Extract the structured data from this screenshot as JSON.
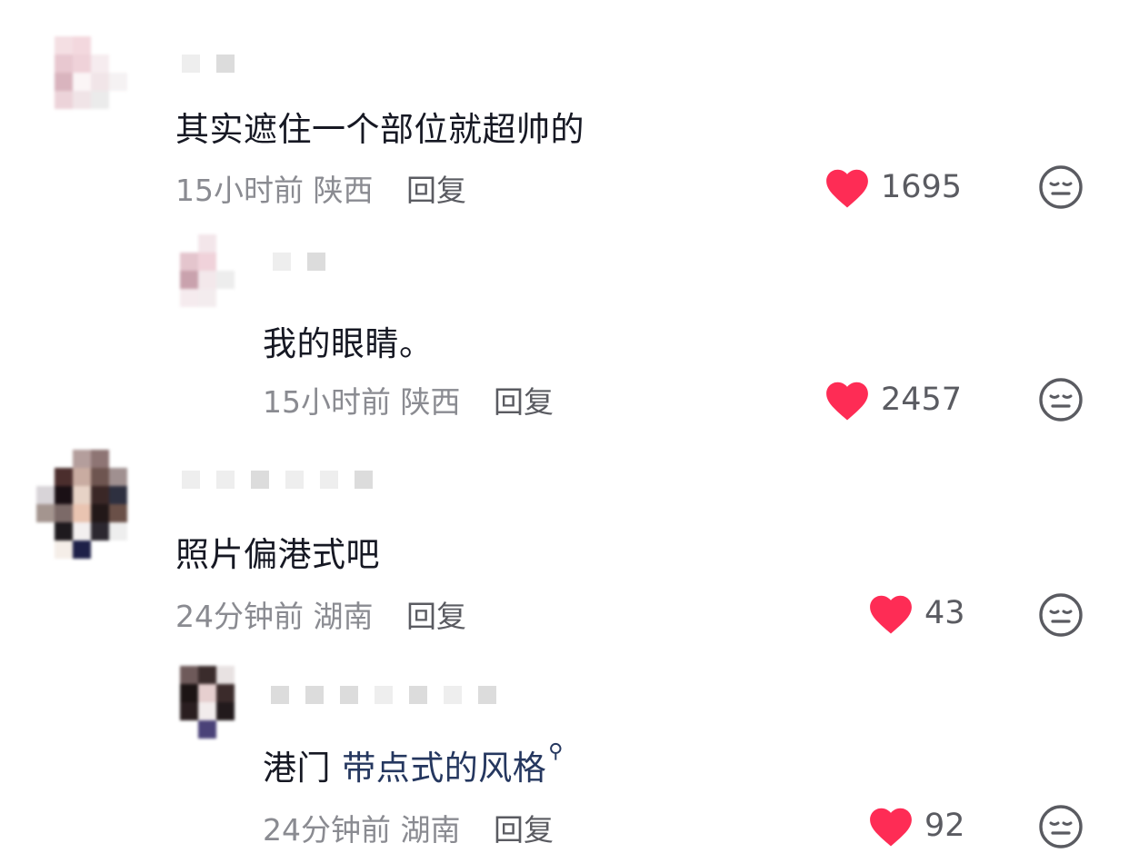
{
  "colors": {
    "like_heart": "#fe2c55",
    "meta": "#8a8b91",
    "link": "#25375f"
  },
  "comments": [
    {
      "text": "其实遮住一个部位就超帅的",
      "time": "15小时前",
      "location": "陕西",
      "reply_label": "回复",
      "likes": "1695"
    },
    {
      "text": "我的眼睛。",
      "time": "15小时前",
      "location": "陕西",
      "reply_label": "回复",
      "likes": "2457"
    },
    {
      "text": "照片偏港式吧",
      "time": "24分钟前",
      "location": "湖南",
      "reply_label": "回复",
      "likes": "43"
    },
    {
      "text_prefix": "港门",
      "text_link": "带点式的风格",
      "time": "24分钟前",
      "location": "湖南",
      "reply_label": "回复",
      "likes": "92"
    }
  ],
  "icons": {
    "like": "heart-icon",
    "dislike": "dislike-face-icon",
    "search": "search-icon"
  }
}
